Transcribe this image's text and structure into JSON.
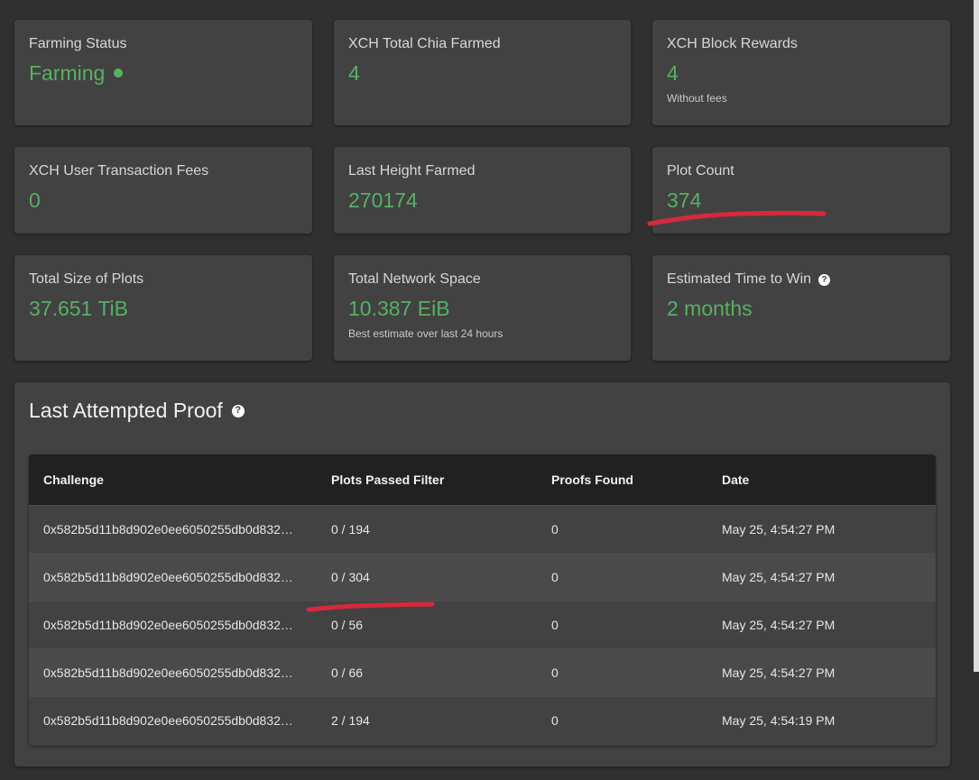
{
  "cards": {
    "farming_status": {
      "label": "Farming Status",
      "value": "Farming"
    },
    "total_farmed": {
      "label": "XCH Total Chia Farmed",
      "value": "4"
    },
    "block_rewards": {
      "label": "XCH Block Rewards",
      "value": "4",
      "caption": "Without fees"
    },
    "tx_fees": {
      "label": "XCH User Transaction Fees",
      "value": "0"
    },
    "last_height": {
      "label": "Last Height Farmed",
      "value": "270174"
    },
    "plot_count": {
      "label": "Plot Count",
      "value": "374"
    },
    "total_size": {
      "label": "Total Size of Plots",
      "value": "37.651 TiB"
    },
    "network_space": {
      "label": "Total Network Space",
      "value": "10.387 EiB",
      "caption": "Best estimate over last 24 hours"
    },
    "time_to_win": {
      "label": "Estimated Time to Win",
      "value": "2 months"
    }
  },
  "proof_panel": {
    "title": "Last Attempted Proof",
    "columns": [
      "Challenge",
      "Plots Passed Filter",
      "Proofs Found",
      "Date"
    ],
    "rows": [
      {
        "challenge": "0x582b5d11b8d902e0ee6050255db0d832…",
        "plots": "0 / 194",
        "proofs": "0",
        "date": "May 25, 4:54:27 PM"
      },
      {
        "challenge": "0x582b5d11b8d902e0ee6050255db0d832…",
        "plots": "0 / 304",
        "proofs": "0",
        "date": "May 25, 4:54:27 PM"
      },
      {
        "challenge": "0x582b5d11b8d902e0ee6050255db0d832…",
        "plots": "0 / 56",
        "proofs": "0",
        "date": "May 25, 4:54:27 PM"
      },
      {
        "challenge": "0x582b5d11b8d902e0ee6050255db0d832…",
        "plots": "0 / 66",
        "proofs": "0",
        "date": "May 25, 4:54:27 PM"
      },
      {
        "challenge": "0x582b5d11b8d902e0ee6050255db0d832…",
        "plots": "2 / 194",
        "proofs": "0",
        "date": "May 25, 4:54:19 PM"
      }
    ]
  },
  "icons": {
    "status": "status-dot-icon",
    "help": "help-circle-icon"
  },
  "colors": {
    "accent_green": "#56b163",
    "card_bg": "#424242",
    "page_bg": "#303030",
    "table_header_bg": "#212121",
    "annotation_red": "#d8283c"
  }
}
